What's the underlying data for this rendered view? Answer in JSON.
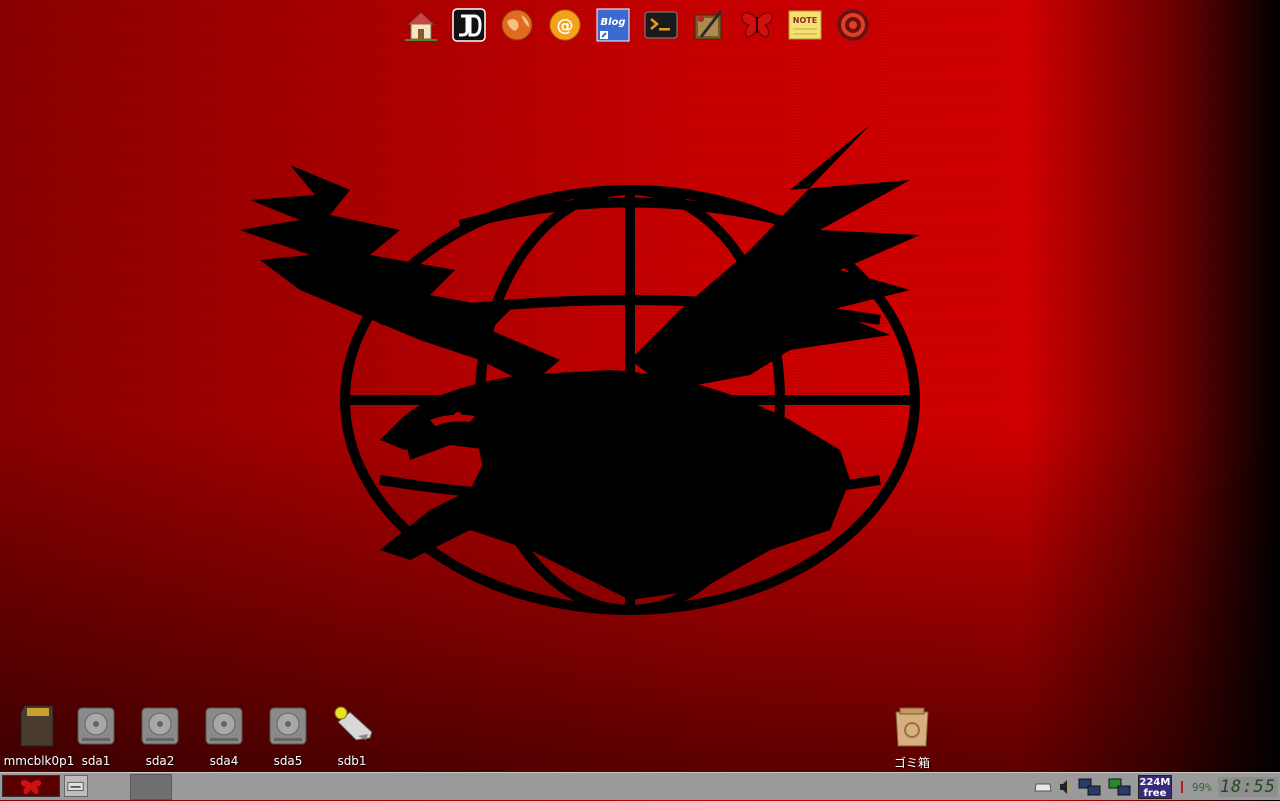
{
  "launcher": {
    "icons": [
      "home-icon",
      "jd-icon",
      "browser-globe-icon",
      "mail-at-icon",
      "blog-icon",
      "terminal-icon",
      "paint-icon",
      "butterfly-icon",
      "note-icon",
      "target-icon"
    ],
    "note_text": "NOTE",
    "blog_text": "Blog"
  },
  "desktop": {
    "drives": [
      {
        "label": "mmcblk0p1",
        "icon": "sd-card-icon"
      },
      {
        "label": "sda1",
        "icon": "hard-drive-icon"
      },
      {
        "label": "sda2",
        "icon": "hard-drive-icon"
      },
      {
        "label": "sda4",
        "icon": "hard-drive-icon"
      },
      {
        "label": "sda5",
        "icon": "hard-drive-icon"
      },
      {
        "label": "sdb1",
        "icon": "usb-drive-icon"
      }
    ],
    "trash": {
      "label": "ゴミ箱",
      "icon": "trash-icon"
    }
  },
  "taskbar": {
    "memory_value": "224M",
    "memory_label": "free",
    "battery": "99%",
    "clock": "18:55"
  },
  "colors": {
    "wallpaper": "#c80000",
    "taskbar": "#9a9a9a",
    "clock": "#1e4a1e"
  }
}
